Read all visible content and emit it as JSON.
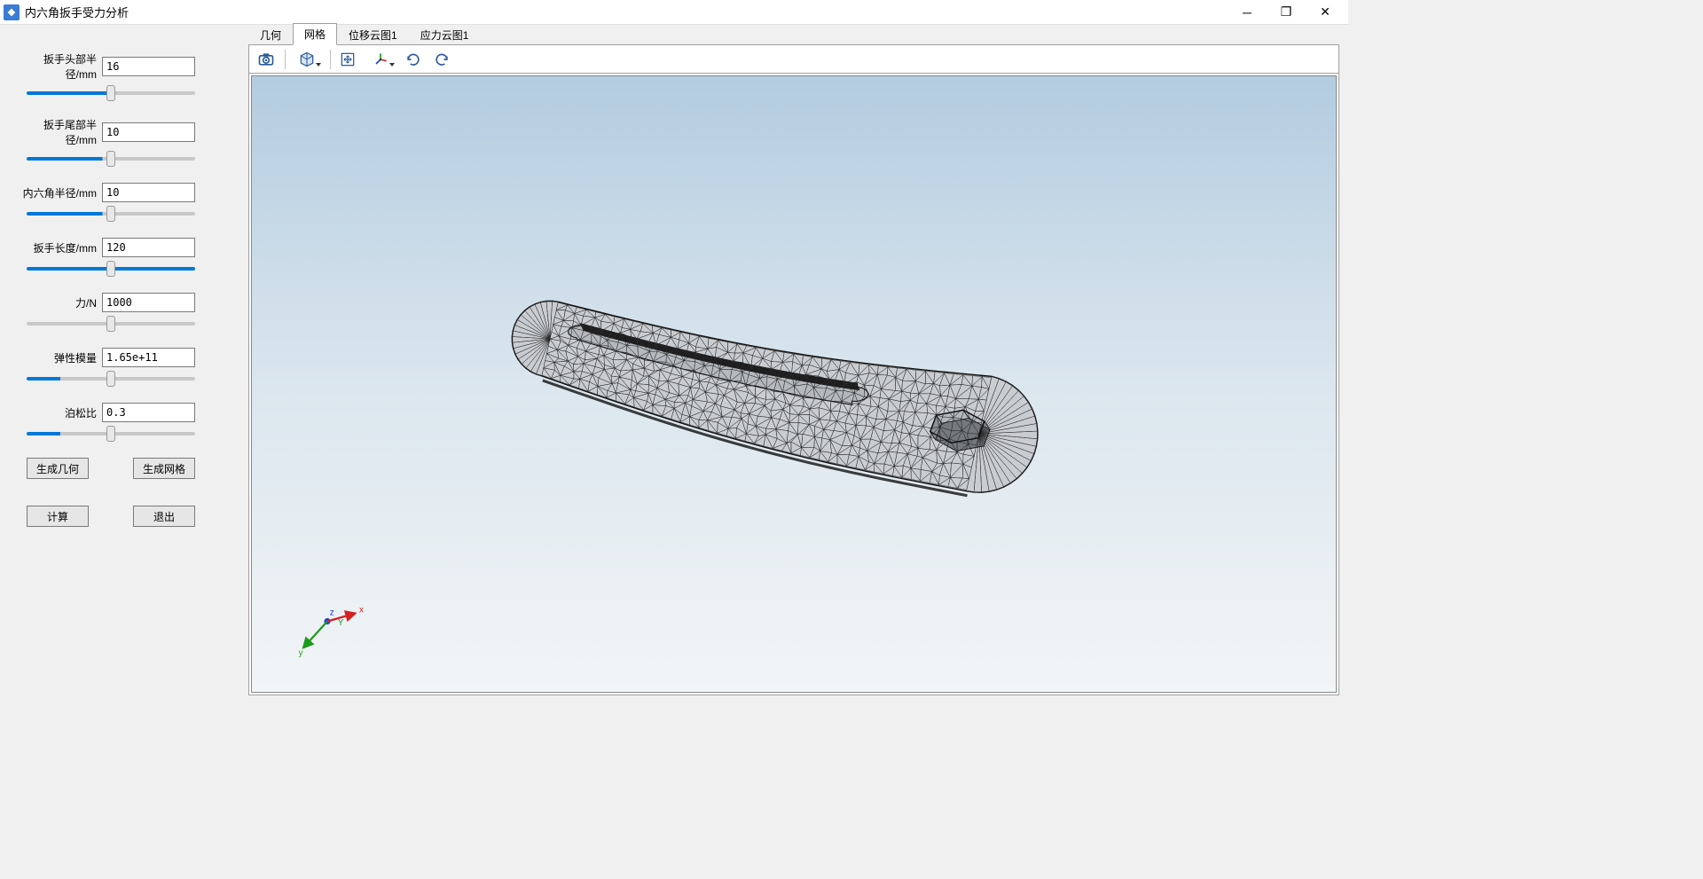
{
  "app": {
    "title": "内六角扳手受力分析"
  },
  "tabs": [
    {
      "label": "几何"
    },
    {
      "label": "网格"
    },
    {
      "label": "位移云图1"
    },
    {
      "label": "应力云图1"
    }
  ],
  "active_tab_index": 1,
  "params": [
    {
      "label": "扳手头部半径/mm",
      "value": "16",
      "fill": 50
    },
    {
      "label": "扳手尾部半径/mm",
      "value": "10",
      "fill": 45
    },
    {
      "label": "内六角半径/mm",
      "value": "10",
      "fill": 45
    },
    {
      "label": "扳手长度/mm",
      "value": "120",
      "fill": 100
    },
    {
      "label": "力/N",
      "value": "1000",
      "fill": 0
    },
    {
      "label": "弹性模量",
      "value": "1.65e+11",
      "fill": 20
    },
    {
      "label": "泊松比",
      "value": "0.3",
      "fill": 20
    }
  ],
  "buttons": {
    "generate_geom": "生成几何",
    "generate_mesh": "生成网格",
    "compute": "计算",
    "exit": "退出"
  },
  "toolbar_icons": [
    "camera-icon",
    "cube-view-icon",
    "fit-view-icon",
    "axes-icon",
    "rotate-left-icon",
    "rotate-right-icon"
  ],
  "coord_labels": {
    "x": "x",
    "y": "y",
    "z": "z"
  }
}
